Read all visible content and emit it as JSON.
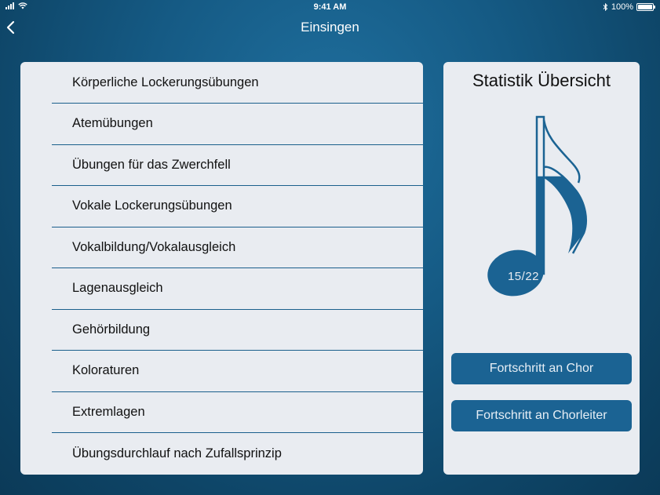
{
  "status_bar": {
    "time": "9:41 AM",
    "battery_text": "100%",
    "icons": [
      "signal-icon",
      "wifi-icon",
      "bluetooth-icon",
      "battery-icon"
    ]
  },
  "nav": {
    "title": "Einsingen",
    "back_icon": "chevron-left-icon"
  },
  "exercises": [
    "Körperliche Lockerungsübungen",
    "Atemübungen",
    "Übungen für das Zwerchfell",
    "Vokale Lockerungsübungen",
    "Vokalbildung/Vokalausgleich",
    "Lagenausgleich",
    "Gehörbildung",
    "Koloraturen",
    "Extremlagen",
    "Übungsdurchlauf nach Zufallsprinzip"
  ],
  "stats": {
    "title": "Statistik Übersicht",
    "progress_text": "15/22",
    "progress_done": 15,
    "progress_total": 22,
    "note_icon": "music-note-icon",
    "button_choir": "Fortschritt an Chor",
    "button_choir_leader": "Fortschritt an Chorleiter"
  },
  "colors": {
    "accent": "#1b6393",
    "panel": "#e9ecf1",
    "background": "#155a84"
  }
}
